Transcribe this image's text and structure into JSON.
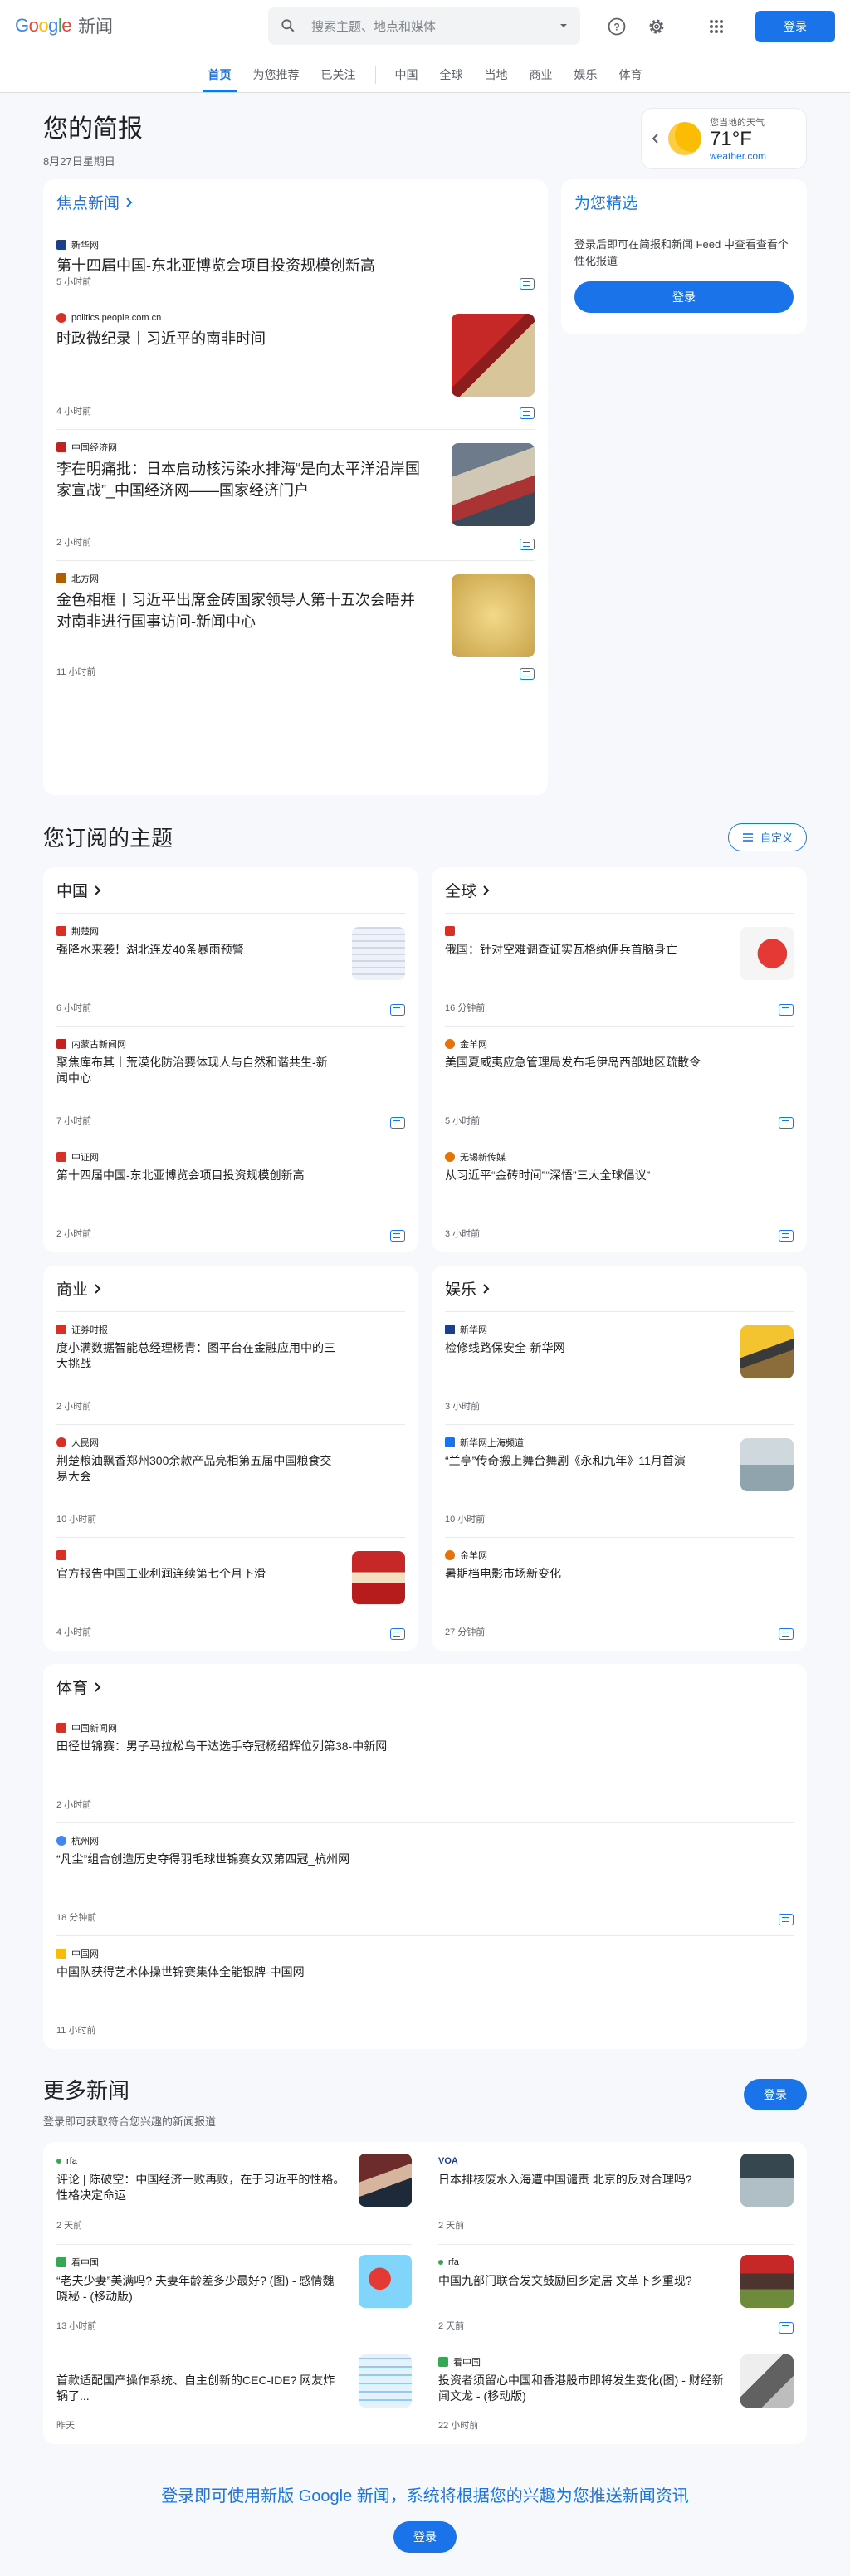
{
  "header": {
    "logo_google": "Google",
    "logo_news": "新闻",
    "search_placeholder": "搜索主题、地点和媒体",
    "signin": "登录"
  },
  "nav": {
    "tabs": [
      {
        "label": "首页"
      },
      {
        "label": "为您推荐"
      },
      {
        "label": "已关注"
      },
      {
        "label": "中国"
      },
      {
        "label": "全球"
      },
      {
        "label": "当地"
      },
      {
        "label": "商业"
      },
      {
        "label": "娱乐"
      },
      {
        "label": "体育"
      }
    ]
  },
  "briefing": {
    "title": "您的简报",
    "date": "8月27日星期日"
  },
  "weather": {
    "location": "您当地的天气",
    "temp": "71°F",
    "source": "weather.com"
  },
  "top": {
    "title": "焦点新闻",
    "articles": [
      {
        "source": "新华网",
        "title": "第十四届中国-东北亚博览会项目投资规模创新高",
        "time": "5 小时前",
        "color": "#1a3f8f"
      },
      {
        "source": "politics.people.com.cn",
        "title": "时政微纪录丨习近平的南非时间",
        "time": "4 小时前",
        "color": "#d93025"
      },
      {
        "source": "中国经济网",
        "title": "李在明痛批：日本启动核污染水排海“是向太平洋沿岸国家宣战”_中国经济网——国家经济门户",
        "time": "2 小时前",
        "color": "#c5221f"
      },
      {
        "source": "北方网",
        "title": "金色相框丨习近平出席金砖国家领导人第十五次会晤并对南非进行国事访问-新闻中心",
        "time": "11 小时前",
        "color": "#b06000"
      }
    ]
  },
  "picks": {
    "title": "为您精选",
    "desc": "登录后即可在简报和新闻 Feed 中查看查看个性化报道",
    "btn": "登录"
  },
  "subscribed": {
    "title": "您订阅的主题",
    "customize": "自定义"
  },
  "topics": [
    {
      "title": "中国",
      "articles": [
        {
          "source": "荆楚网",
          "title": "强降水来袭！湖北连发40条暴雨预警",
          "time": "6 小时前",
          "color": "#d93025"
        },
        {
          "source": "内蒙古新闻网",
          "title": "聚焦库布其丨荒漠化防治要体现人与自然和谐共生-新闻中心",
          "time": "7 小时前",
          "color": "#c5221f"
        },
        {
          "source": "中证网",
          "title": "第十四届中国-东北亚博览会项目投资规模创新高",
          "time": "2 小时前",
          "color": "#d93025"
        }
      ]
    },
    {
      "title": "全球",
      "articles": [
        {
          "source": "",
          "title": "俄国：针对空难调查证实瓦格纳佣兵首脑身亡",
          "time": "16 分钟前",
          "color": "#d93025"
        },
        {
          "source": "金羊网",
          "title": "美国夏威夷应急管理局发布毛伊岛西部地区疏散令",
          "time": "5 小时前",
          "color": "#e8710a"
        },
        {
          "source": "无锡新传媒",
          "title": "从习近平“金砖时间”“深悟”三大全球倡议”",
          "time": "3 小时前",
          "color": "#e37400"
        }
      ]
    },
    {
      "title": "商业",
      "articles": [
        {
          "source": "证券时报",
          "title": "度小满数据智能总经理杨青：图平台在金融应用中的三大挑战",
          "time": "2 小时前",
          "color": "#d93025"
        },
        {
          "source": "人民网",
          "title": "荆楚粮油飘香郑州300余款产品亮相第五届中国粮食交易大会",
          "time": "10 小时前",
          "color": "#d93025"
        },
        {
          "source": "",
          "title": "官方报告中国工业利润连续第七个月下滑",
          "time": "4 小时前",
          "color": "#d93025"
        }
      ]
    },
    {
      "title": "娱乐",
      "articles": [
        {
          "source": "新华网",
          "title": "检修线路保安全-新华网",
          "time": "3 小时前",
          "color": "#1a3f8f"
        },
        {
          "source": "新华网上海频道",
          "title": "“兰亭”传奇搬上舞台舞剧《永和九年》11月首演",
          "time": "10 小时前",
          "color": "#1a73e8"
        },
        {
          "source": "金羊网",
          "title": "暑期档电影市场新变化",
          "time": "27 分钟前",
          "color": "#e8710a"
        }
      ]
    }
  ],
  "sports": {
    "title": "体育",
    "articles": [
      {
        "source": "中国新闻网",
        "title": "田径世锦赛：男子马拉松乌干达选手夺冠杨绍辉位列第38-中新网",
        "time": "2 小时前",
        "color": "#d93025"
      },
      {
        "source": "杭州网",
        "title": "“凡尘”组合创造历史夺得羽毛球世锦赛女双第四冠_杭州网",
        "time": "18 分钟前",
        "color": "#4285f4"
      },
      {
        "source": "中国网",
        "title": "中国队获得艺术体操世锦赛集体全能银牌-中国网",
        "time": "11 小时前",
        "color": "#fbbc04"
      }
    ]
  },
  "more_news": {
    "title": "更多新闻",
    "subtitle": "登录即可获取符合您兴趣的新闻报道",
    "btn": "登录",
    "articles": [
      {
        "source": "rfa",
        "title": "评论 | 陈破空：中国经济一败再败，在于习近平的性格。性格决定命运",
        "time": "2 天前",
        "color": "#34a853"
      },
      {
        "source": "VOA",
        "title": "日本排核废水入海遭中国谴责 北京的反对合理吗?",
        "time": "2 天前",
        "color": "#1a3f8f"
      },
      {
        "source": "看中国",
        "title": "“老夫少妻”美满吗? 夫妻年龄差多少最好? (图) - 感情魏晓秘 - (移动版)",
        "time": "13 小时前",
        "color": "#34a853"
      },
      {
        "source": "rfa",
        "title": "中国九部门联合发文鼓励回乡定居 文革下乡重现?",
        "time": "2 天前",
        "color": "#34a853"
      },
      {
        "source": "",
        "title": "首款适配国产操作系统、自主创新的CEC-IDE? 网友炸锅了...",
        "time": "昨天",
        "color": "#5f6368"
      },
      {
        "source": "看中国",
        "title": "投资者须留心中国和香港股市即将发生变化(图) - 财经新闻文龙 - (移动版)",
        "time": "22 小时前",
        "color": "#34a853"
      }
    ]
  },
  "footer": {
    "promo": "登录即可使用新版 Google 新闻，系统将根据您的兴趣为您推送新闻资讯",
    "btn": "登录"
  }
}
